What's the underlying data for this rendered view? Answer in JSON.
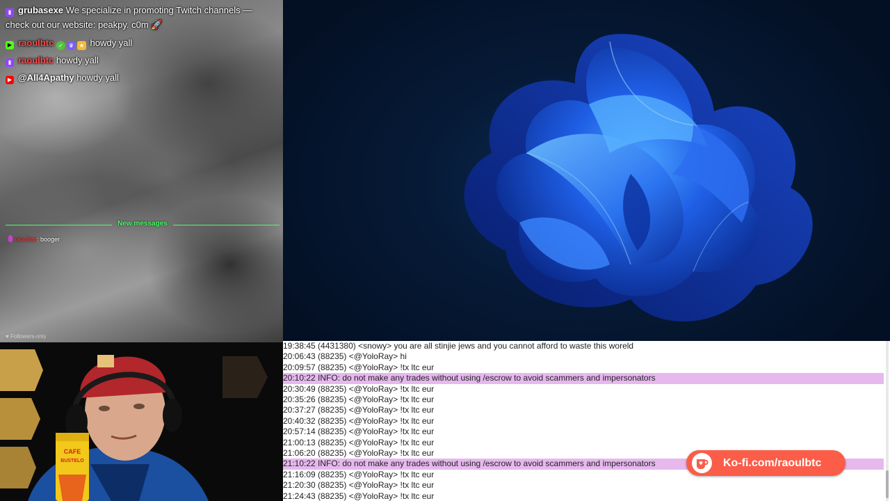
{
  "chat": {
    "messages": [
      {
        "platform": "twitch-icon",
        "user": "grubasexe",
        "text": "We specialize in promoting Twitch channels — check out our website: peakpy. c0m 🚀"
      },
      {
        "platform": "kick-icon",
        "user": "raoulbtc",
        "text": "howdy yall"
      },
      {
        "platform": "twitch-icon",
        "user": "raoulbtc",
        "text": "howdy yall"
      },
      {
        "platform": "youtube-icon",
        "user": "@All4Apathy",
        "text": "howdy yall"
      }
    ],
    "new_messages_label": "New messages",
    "small_message": {
      "user": "raoulbtc",
      "text": ": booger"
    },
    "footer": "Followers-only"
  },
  "irc": {
    "lines": [
      "19:38:45 (4431380) <snowy> you are all stinjie jews and you cannot afford to waste this woreld",
      "20:06:43 (88235) <@YoloRay> hi",
      "20:09:57 (88235) <@YoloRay> !tx ltc eur",
      "20:10:22 INFO: do not make any trades without using /escrow to avoid scammers and impersonators",
      "20:30:49 (88235) <@YoloRay> !tx ltc eur",
      "20:35:26 (88235) <@YoloRay> !tx ltc eur",
      "20:37:27 (88235) <@YoloRay> !tx ltc eur",
      "20:40:32 (88235) <@YoloRay> !tx ltc eur",
      "20:57:14 (88235) <@YoloRay> !tx ltc eur",
      "21:00:13 (88235) <@YoloRay> !tx ltc eur",
      "21:06:20 (88235) <@YoloRay> !tx ltc eur",
      "21:10:22 INFO: do not make any trades without using /escrow to avoid scammers and impersonators",
      "21:16:09 (88235) <@YoloRay> !tx ltc eur",
      "21:20:30 (88235) <@YoloRay> !tx ltc eur",
      "21:24:43 (88235) <@YoloRay> !tx ltc eur"
    ]
  },
  "kofi": {
    "label": "Ko-fi.com/raoulbtc",
    "icon": "kofi-cup-icon",
    "color": "#fb5d48"
  },
  "webcam": {
    "beanie_label": "",
    "can_text_1": "CAFE",
    "can_text_2": "BUSTELO"
  },
  "colors": {
    "info_highlight": "#e6b8ee",
    "new_messages": "#4cff6a",
    "twitch": "#9146ff",
    "kick": "#53fc18",
    "youtube": "#ff0000"
  }
}
